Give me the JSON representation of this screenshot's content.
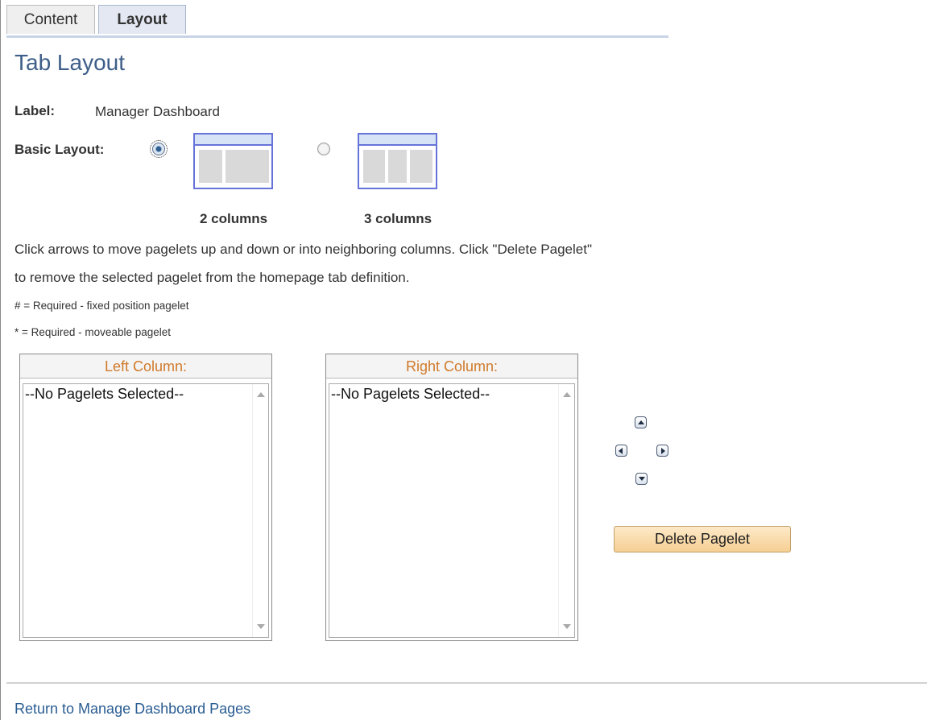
{
  "tabs": [
    {
      "label": "Content",
      "active": false
    },
    {
      "label": "Layout",
      "active": true
    }
  ],
  "page_title": "Tab Layout",
  "label_field": {
    "key": "Label:",
    "value": "Manager Dashboard"
  },
  "basic_layout": {
    "key": "Basic Layout:",
    "options": [
      {
        "caption": "2 columns",
        "selected": true
      },
      {
        "caption": "3 columns",
        "selected": false
      }
    ]
  },
  "instructions": [
    "Click arrows to move pagelets up and down or into neighboring columns. Click \"Delete Pagelet\"",
    "to remove the selected pagelet from the homepage tab definition."
  ],
  "legend": [
    "# = Required - fixed position pagelet",
    "* = Required - moveable pagelet"
  ],
  "columns": [
    {
      "header": "Left Column:",
      "item": "--No Pagelets Selected--"
    },
    {
      "header": "Right Column:",
      "item": "--No Pagelets Selected--"
    }
  ],
  "arrow_icons": [
    "move-up-icon",
    "move-left-icon",
    "move-right-icon",
    "move-down-icon"
  ],
  "delete_button": "Delete Pagelet",
  "return_link": "Return to Manage Dashboard Pages",
  "colors": {
    "title": "#3e5e89",
    "column_header": "#d07a2a",
    "link": "#2a5d93",
    "button_bg": "#f6cf93",
    "layout_border": "#6673d9"
  }
}
